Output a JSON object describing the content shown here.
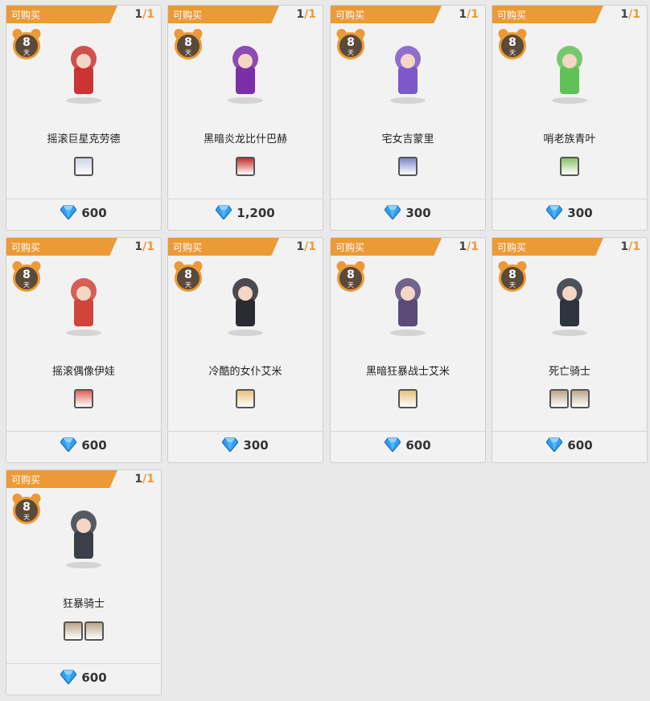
{
  "colors": {
    "accent": "#ec9a35",
    "gem": "#2f9ff1"
  },
  "cards": [
    {
      "status": "可购买",
      "bought": "1",
      "limit": "1",
      "days": "8",
      "day_unit": "天",
      "name": "摇滚巨星克劳德",
      "price": "600",
      "icons": [
        "character-portrait-icon"
      ]
    },
    {
      "status": "可购买",
      "bought": "1",
      "limit": "1",
      "days": "8",
      "day_unit": "天",
      "name": "黑暗炎龙比什巴赫",
      "price": "1,200",
      "icons": [
        "character-portrait-icon"
      ]
    },
    {
      "status": "可购买",
      "bought": "1",
      "limit": "1",
      "days": "8",
      "day_unit": "天",
      "name": "宅女吉蒙里",
      "price": "300",
      "icons": [
        "character-portrait-icon"
      ]
    },
    {
      "status": "可购买",
      "bought": "1",
      "limit": "1",
      "days": "8",
      "day_unit": "天",
      "name": "哨老族青叶",
      "price": "300",
      "icons": [
        "character-portrait-icon"
      ]
    },
    {
      "status": "可购买",
      "bought": "1",
      "limit": "1",
      "days": "8",
      "day_unit": "天",
      "name": "摇滚偶像伊娃",
      "price": "600",
      "icons": [
        "character-portrait-icon"
      ]
    },
    {
      "status": "可购买",
      "bought": "1",
      "limit": "1",
      "days": "8",
      "day_unit": "天",
      "name": "冷酷的女仆艾米",
      "price": "300",
      "icons": [
        "character-portrait-icon"
      ]
    },
    {
      "status": "可购买",
      "bought": "1",
      "limit": "1",
      "days": "8",
      "day_unit": "天",
      "name": "黑暗狂暴战士艾米",
      "price": "600",
      "icons": [
        "character-portrait-icon"
      ]
    },
    {
      "status": "可购买",
      "bought": "1",
      "limit": "1",
      "days": "8",
      "day_unit": "天",
      "name": "死亡骑士",
      "price": "600",
      "icons": [
        "character-portrait-icon",
        "character-portrait-icon"
      ]
    },
    {
      "status": "可购买",
      "bought": "1",
      "limit": "1",
      "days": "8",
      "day_unit": "天",
      "name": "狂暴骑士",
      "price": "600",
      "icons": [
        "character-portrait-icon",
        "character-portrait-icon"
      ]
    }
  ]
}
